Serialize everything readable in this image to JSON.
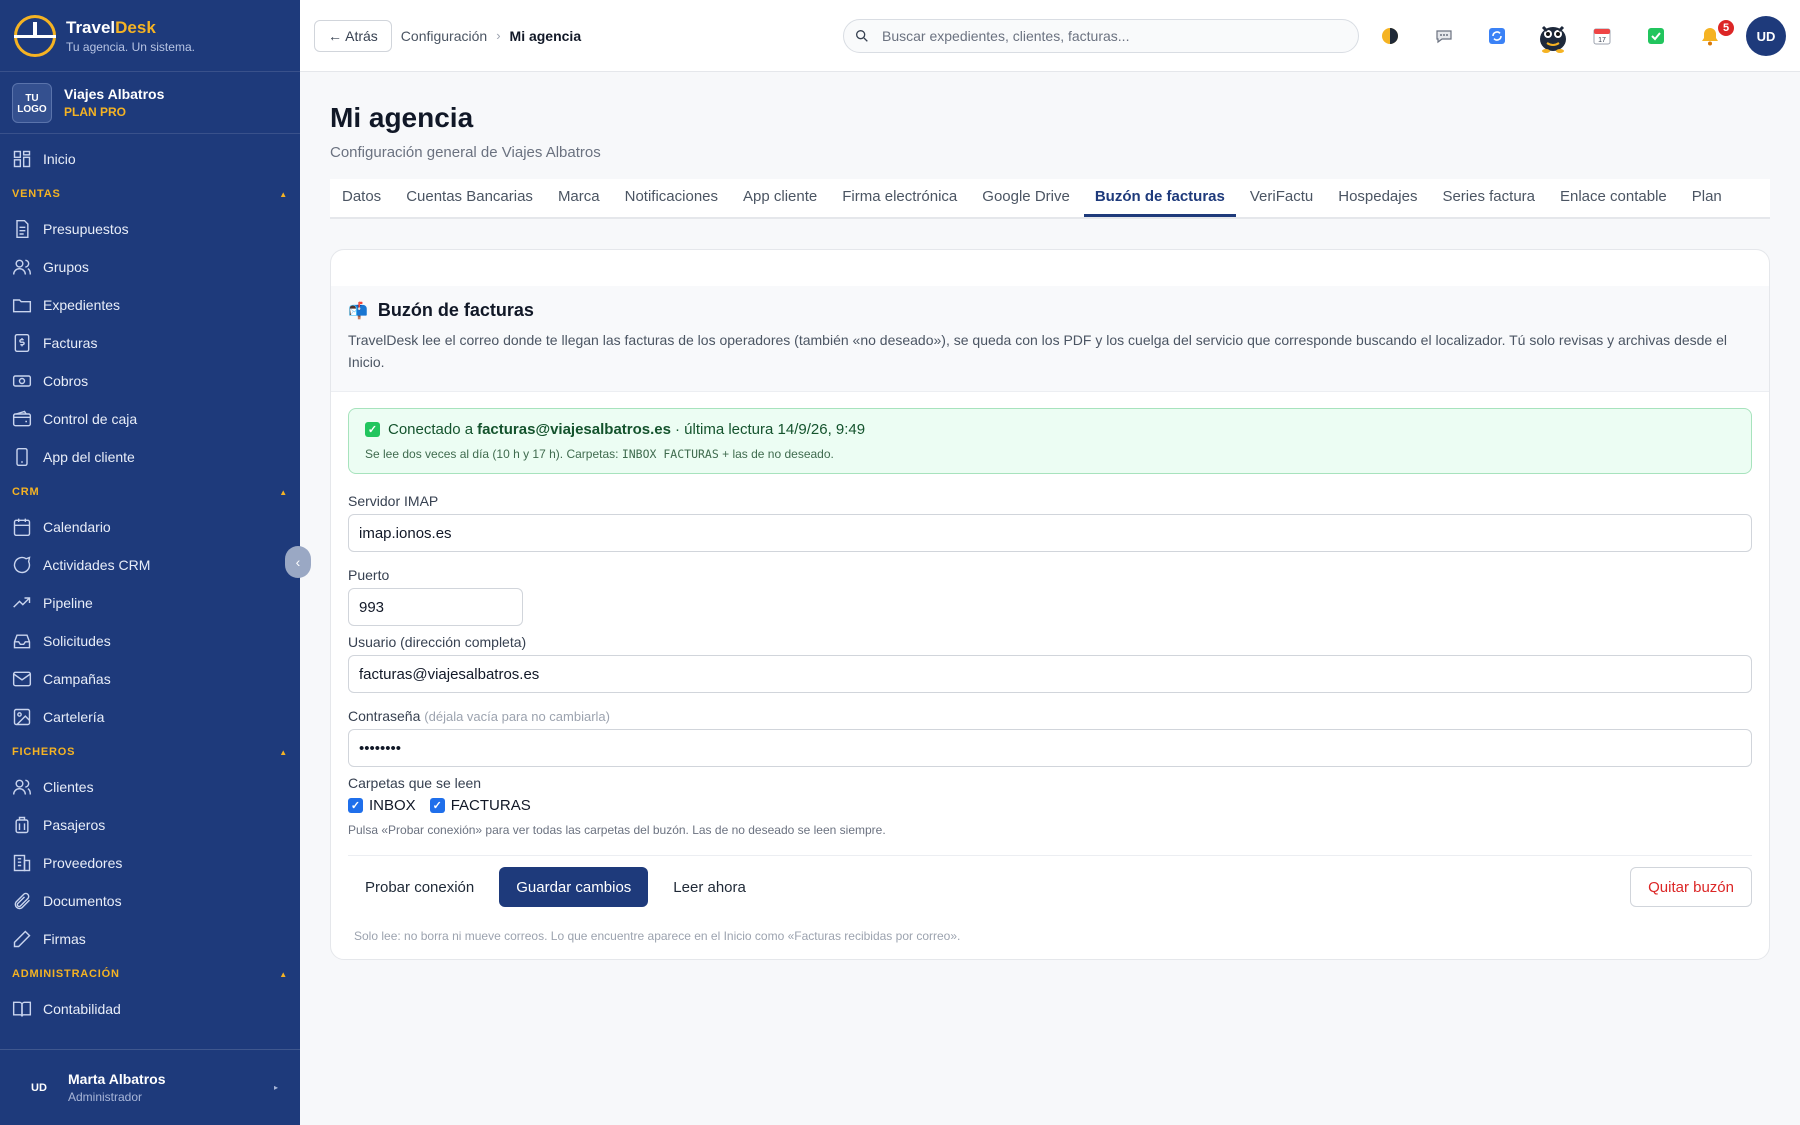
{
  "brand": {
    "name_part1": "Travel",
    "name_part2": "Desk",
    "tagline": "Tu agencia. Un sistema."
  },
  "agency": {
    "logo_text": "TU LOGO",
    "name": "Viajes Albatros",
    "plan": "PLAN PRO"
  },
  "sidebar": {
    "home": "Inicio",
    "sections": [
      {
        "title": "VENTAS",
        "items": [
          "Presupuestos",
          "Grupos",
          "Expedientes",
          "Facturas",
          "Cobros",
          "Control de caja",
          "App del cliente"
        ]
      },
      {
        "title": "CRM",
        "items": [
          "Calendario",
          "Actividades CRM",
          "Pipeline",
          "Solicitudes",
          "Campañas",
          "Cartelería"
        ]
      },
      {
        "title": "FICHEROS",
        "items": [
          "Clientes",
          "Pasajeros",
          "Proveedores",
          "Documentos",
          "Firmas"
        ]
      },
      {
        "title": "ADMINISTRACIÓN",
        "items": [
          "Contabilidad"
        ]
      }
    ],
    "icons": {
      "Inicio": "grid-icon",
      "Presupuestos": "document-icon",
      "Grupos": "users-icon",
      "Expedientes": "folder-icon",
      "Facturas": "invoice-icon",
      "Cobros": "cash-icon",
      "Control de caja": "wallet-icon",
      "App del cliente": "phone-icon",
      "Calendario": "calendar-icon",
      "Actividades CRM": "chat-icon",
      "Pipeline": "trend-icon",
      "Solicitudes": "inbox-icon",
      "Campañas": "mail-icon",
      "Cartelería": "image-icon",
      "Clientes": "users-icon",
      "Pasajeros": "luggage-icon",
      "Proveedores": "building-icon",
      "Documentos": "paperclip-icon",
      "Firmas": "pen-icon",
      "Contabilidad": "book-icon"
    }
  },
  "user": {
    "initials": "UD",
    "name": "Marta Albatros",
    "role": "Administrador"
  },
  "topbar": {
    "back_label": "← Atrás",
    "breadcrumb_parent": "Configuración",
    "breadcrumb_sep": "›",
    "breadcrumb_current": "Mi agencia",
    "search_placeholder": "Buscar expedientes, clientes, facturas...",
    "notification_count": "5",
    "avatar_initials": "UD"
  },
  "page": {
    "title": "Mi agencia",
    "subtitle": "Configuración general de Viajes Albatros"
  },
  "tabs": [
    "Datos",
    "Cuentas Bancarias",
    "Marca",
    "Notificaciones",
    "App cliente",
    "Firma electrónica",
    "Google Drive",
    "Buzón de facturas",
    "VeriFactu",
    "Hospedajes",
    "Series factura",
    "Enlace contable",
    "Plan"
  ],
  "active_tab": "Buzón de facturas",
  "mailbox": {
    "emoji": "📬",
    "title": "Buzón de facturas",
    "description": "TravelDesk lee el correo donde te llegan las facturas de los operadores (también «no deseado»), se queda con los PDF y los cuelga del servicio que corresponde buscando el localizador. Tú solo revisas y archivas desde el Inicio.",
    "status_prefix": "Conectado a",
    "status_email": "facturas@viajesalbatros.es",
    "status_suffix": "· última lectura 14/9/26, 9:49",
    "status_note_prefix": "Se lee dos veces al día (10 h y 17 h). Carpetas:",
    "status_note_folders": "INBOX FACTURAS",
    "status_note_suffix": "+ las de no deseado.",
    "server_label": "Servidor IMAP",
    "server_value": "imap.ionos.es",
    "port_label": "Puerto",
    "port_value": "993",
    "user_label": "Usuario (dirección completa)",
    "user_value": "facturas@viajesalbatros.es",
    "password_label": "Contraseña",
    "password_hint": "(déjala vacía para no cambiarla)",
    "password_value": "••••••••",
    "folders_label": "Carpetas que se leen",
    "folders": [
      {
        "name": "INBOX",
        "checked": true
      },
      {
        "name": "FACTURAS",
        "checked": true
      }
    ],
    "folders_note": "Pulsa «Probar conexión» para ver todas las carpetas del buzón. Las de no deseado se leen siempre.",
    "btn_test": "Probar conexión",
    "btn_save": "Guardar cambios",
    "btn_read": "Leer ahora",
    "btn_remove": "Quitar buzón",
    "footer_note": "Solo lee: no borra ni mueve correos. Lo que encuentre aparece en el Inicio como «Facturas recibidas por correo»."
  },
  "colors": {
    "sidebar_bg": "#1e3a7b",
    "accent": "#f5b323",
    "primary": "#1e3a7b",
    "danger": "#dc2626",
    "success_bg": "#ecfdf3"
  }
}
